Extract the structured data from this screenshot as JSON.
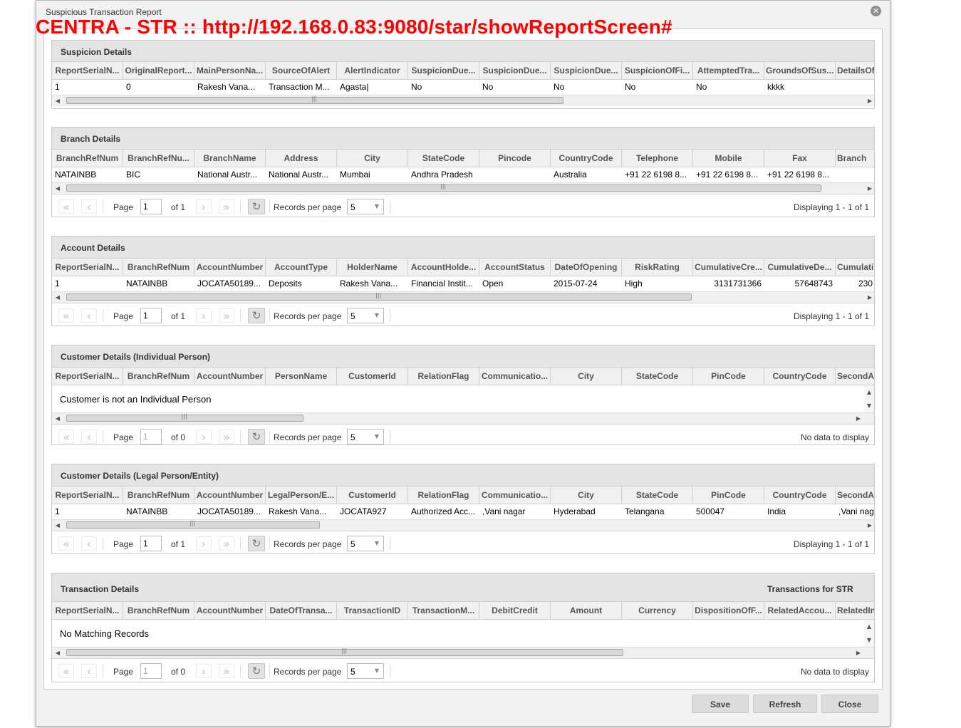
{
  "window": {
    "title": "Suspicious Transaction Report",
    "close_icon": "close-circle-icon",
    "url_banner": "CENTRA - STR :: http://192.168.0.83:9080/star/showReportScreen#"
  },
  "pager_labels": {
    "page": "Page",
    "records_per_page": "Records per page"
  },
  "suspicion": {
    "title": "Suspicion Details",
    "columns": [
      "ReportSerialN...",
      "OriginalReport...",
      "MainPersonNa...",
      "SourceOfAlert",
      "AlertIndicator",
      "SuspicionDue...",
      "SuspicionDue...",
      "SuspicionDue...",
      "SuspicionOfFi...",
      "AttemptedTra...",
      "GroundsOfSus...",
      "DetailsOf"
    ],
    "rows": [
      [
        "1",
        "0",
        "Rakesh Vana...",
        "Transaction M...",
        "Agasta|",
        "No",
        "No",
        "No",
        "No",
        "No",
        "kkkk",
        ""
      ]
    ]
  },
  "branch": {
    "title": "Branch Details",
    "columns": [
      "BranchRefNum",
      "BranchRefNu...",
      "BranchName",
      "Address",
      "City",
      "StateCode",
      "Pincode",
      "CountryCode",
      "Telephone",
      "Mobile",
      "Fax",
      "Branch"
    ],
    "rows": [
      [
        "NATAINBB",
        "BIC",
        "National Austr...",
        "National Austr...",
        "Mumbai",
        "Andhra Pradesh",
        "",
        "Australia",
        "+91 22 6198 8...",
        "+91 22 6198 8...",
        "+91 22 6198 8...",
        ""
      ]
    ],
    "pager": {
      "page": "1",
      "of": "of 1",
      "per_page": "5",
      "display": "Displaying 1 - 1 of 1"
    }
  },
  "account": {
    "title": "Account Details",
    "columns": [
      "ReportSerialN...",
      "BranchRefNum",
      "AccountNumber",
      "AccountType",
      "HolderName",
      "AccountHolde...",
      "AccountStatus",
      "DateOfOpening",
      "RiskRating",
      "CumulativeCre...",
      "CumulativeDe...",
      "Cumulati"
    ],
    "rows": [
      [
        "1",
        "NATAINBB",
        "JOCATA50189...",
        "Deposits",
        "Rakesh Vana...",
        "Financial Instit...",
        "Open",
        "2015-07-24",
        "High",
        "3131731366",
        "57648743",
        "230"
      ]
    ],
    "pager": {
      "page": "1",
      "of": "of 1",
      "per_page": "5",
      "display": "Displaying 1 - 1 of 1"
    }
  },
  "customer_individual": {
    "title": "Customer Details (Individual Person)",
    "columns": [
      "ReportSerialN...",
      "BranchRefNum",
      "AccountNumber",
      "PersonName",
      "CustomerId",
      "RelationFlag",
      "Communicatio...",
      "City",
      "StateCode",
      "PinCode",
      "CountryCode",
      "SecondA"
    ],
    "message": "Customer is not an Individual Person",
    "pager": {
      "page": "1",
      "of": "of 0",
      "per_page": "5",
      "display": "No data to display"
    }
  },
  "customer_legal": {
    "title": "Customer Details (Legal Person/Entity)",
    "columns": [
      "ReportSerialN...",
      "BranchRefNum",
      "AccountNumber",
      "LegalPerson/E...",
      "CustomerId",
      "RelationFlag",
      "Communicatio...",
      "City",
      "StateCode",
      "PinCode",
      "CountryCode",
      "SecondA"
    ],
    "rows": [
      [
        "1",
        "NATAINBB",
        "JOCATA50189...",
        "Rakesh Vana...",
        "JOCATA927",
        "Authorized Acc...",
        ",Vani nagar",
        "Hyderabad",
        "Telangana",
        "500047",
        "India",
        ",Vani nag"
      ]
    ],
    "pager": {
      "page": "1",
      "of": "of 1",
      "per_page": "5",
      "display": "Displaying 1 - 1 of 1"
    }
  },
  "transaction": {
    "title": "Transaction Details",
    "subtitle": "Transactions for STR",
    "columns": [
      "ReportSerialN...",
      "BranchRefNum",
      "AccountNumber",
      "DateOfTransa...",
      "TransactionID",
      "TransactionM...",
      "DebitCredit",
      "Amount",
      "Currency",
      "DispositionOfF...",
      "RelatedAccou...",
      "RelatedIn"
    ],
    "message": "No Matching Records",
    "pager": {
      "page": "1",
      "of": "of 0",
      "per_page": "5",
      "display": "No data to display"
    }
  },
  "footer": {
    "save": "Save",
    "refresh": "Refresh",
    "close": "Close"
  }
}
